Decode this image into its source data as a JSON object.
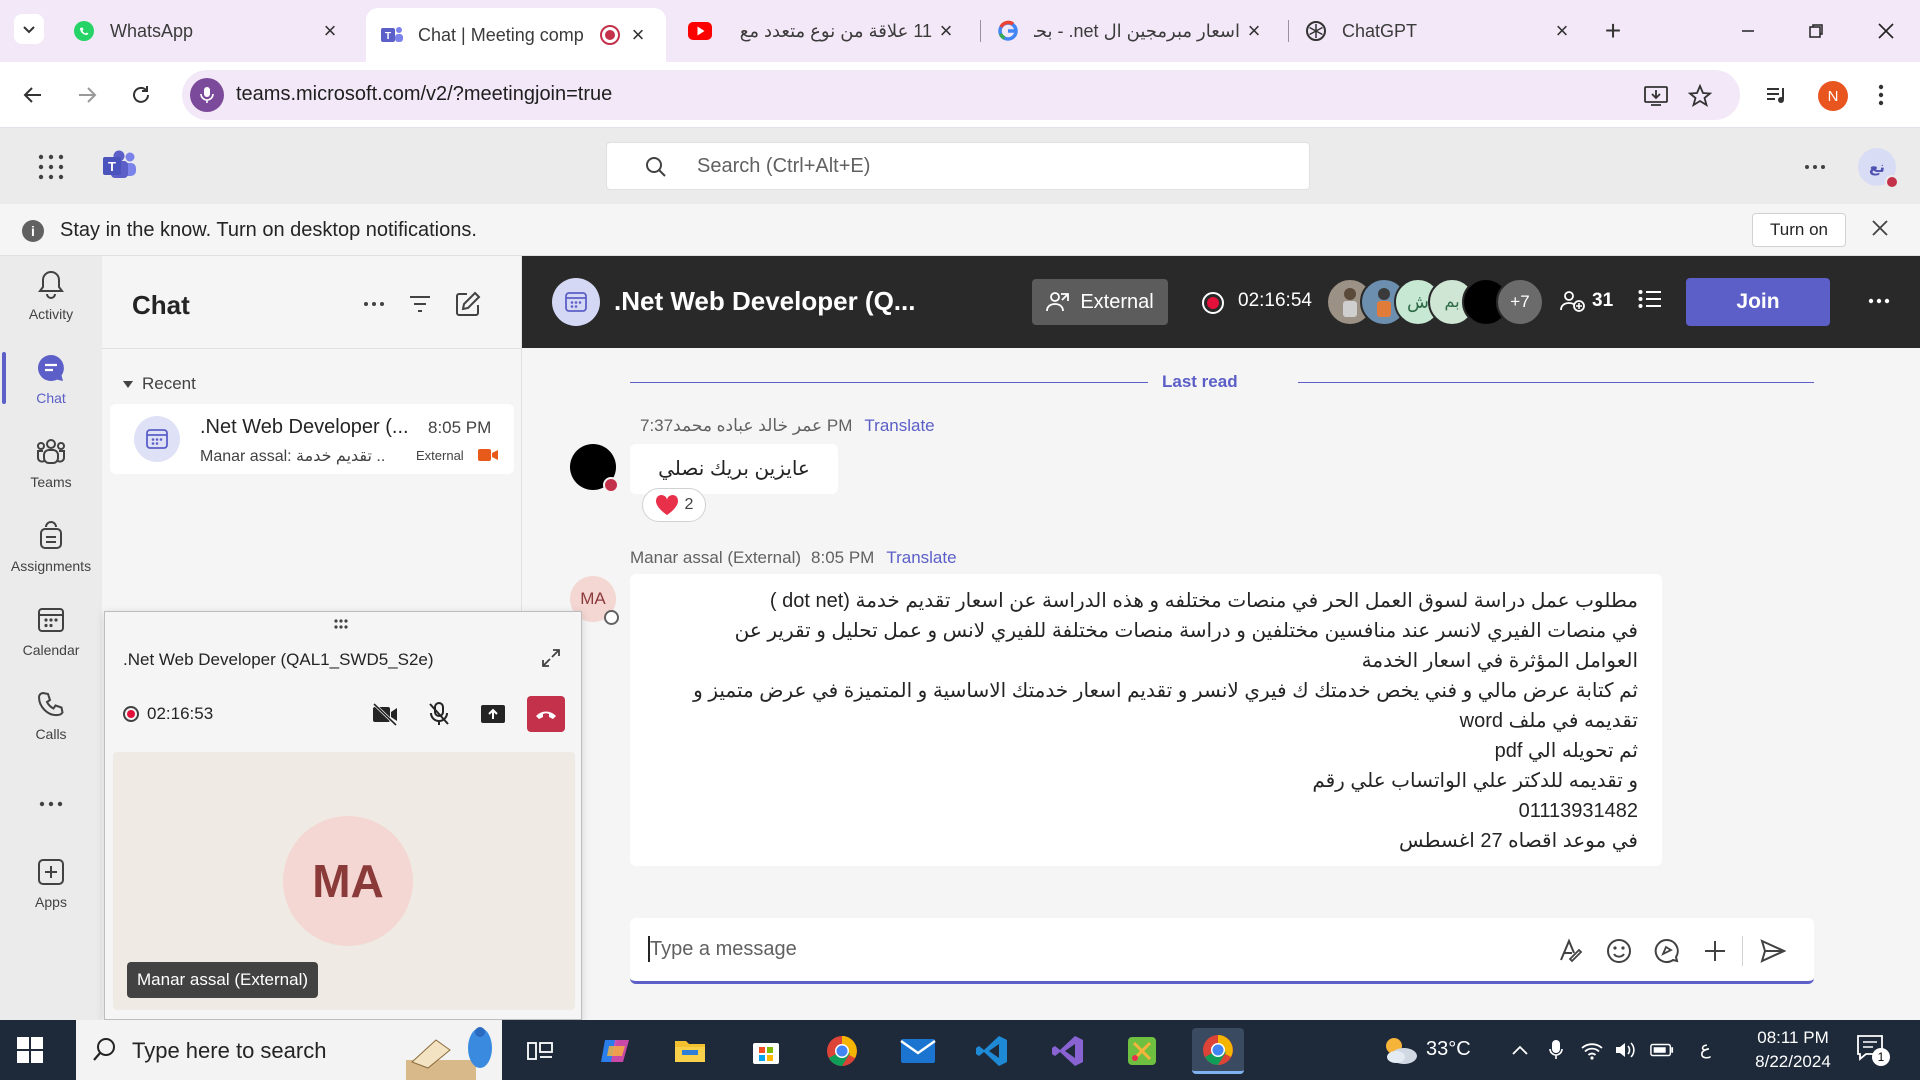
{
  "browser": {
    "tabs": [
      {
        "label": "WhatsApp",
        "icon": "whatsapp-icon"
      },
      {
        "label": "Chat | Meeting comp",
        "icon": "teams-icon"
      },
      {
        "label": "11 علاقة من نوع متعدد مع",
        "icon": "youtube-icon"
      },
      {
        "label": "اسعار مبرمجين ال net. - بحث",
        "icon": "google-icon"
      },
      {
        "label": "ChatGPT",
        "icon": "chatgpt-icon"
      }
    ],
    "new_tab_label": "+",
    "url": "teams.microsoft.com/v2/?meetingjoin=true",
    "profile_initial": "N"
  },
  "teams": {
    "search_placeholder": "Search (Ctrl+Alt+E)",
    "user_initials": "نع",
    "notification": {
      "text": "Stay in the know. Turn on desktop notifications.",
      "button": "Turn on"
    },
    "rail": [
      {
        "label": "Activity",
        "icon": "bell-icon"
      },
      {
        "label": "Chat",
        "icon": "chat-icon"
      },
      {
        "label": "Teams",
        "icon": "teams-people-icon"
      },
      {
        "label": "Assignments",
        "icon": "assignments-icon"
      },
      {
        "label": "Calendar",
        "icon": "calendar-icon"
      },
      {
        "label": "Calls",
        "icon": "phone-icon"
      },
      {
        "label": "...",
        "icon": "more-icon"
      },
      {
        "label": "Apps",
        "icon": "apps-icon"
      }
    ],
    "chat_pane": {
      "title": "Chat",
      "section": "Recent",
      "items": [
        {
          "name": ".Net Web Developer (...",
          "time": "8:05 PM",
          "preview": "Manar assal: تقديم خدمة ...",
          "badge": "External"
        }
      ]
    },
    "meeting": {
      "title": ".Net Web Developer (Q...",
      "external_label": "External",
      "timer": "02:16:54",
      "participant_initials": [
        "ش",
        "بم"
      ],
      "overflow_count": "+7",
      "people_count": "31",
      "join_label": "Join"
    },
    "conversation": {
      "last_read": "Last read",
      "messages": [
        {
          "sender": "عمر خالد عباده محمد",
          "time": "7:37 PM",
          "translate": "Translate",
          "text": "عايزين بريك نصلي",
          "reaction_count": "2"
        },
        {
          "sender": "Manar assal (External)",
          "avatar": "MA",
          "time": "8:05 PM",
          "translate": "Translate",
          "lines": [
            "مطلوب عمل دراسة لسوق العمل الحر في منصات مختلفه و هذه الدراسة عن اسعار تقديم خدمة (dot net )",
            "في منصات الفيري لانسر عند منافسين مختلفين و دراسة منصات مختلفة للفيري لانس و عمل تحليل و تقرير عن",
            "العوامل المؤثرة في اسعار الخدمة",
            "ثم كتابة عرض مالي و فني يخص خدمتك ك فيري لانسر  و تقديم اسعار خدمتك الاساسية و المتميزة في عرض متميز و",
            "تقديمه في ملف word",
            "ثم تحويله الي pdf",
            "و تقديمه للدكتر علي الواتساب علي رقم",
            "01113931482",
            "في موعد اقصاه 27 اغسطس"
          ]
        }
      ],
      "compose_placeholder": "Type a message"
    },
    "call_window": {
      "title": ".Net Web Developer (QAL1_SWD5_S2e)",
      "timer": "02:16:53",
      "avatar": "MA",
      "name_tag": "Manar assal (External)"
    }
  },
  "taskbar": {
    "search_placeholder": "Type here to search",
    "temperature": "33°C",
    "language": "ع",
    "time": "08:11 PM",
    "date": "8/22/2024",
    "notification_count": "1"
  },
  "colors": {
    "teams_accent": "#5b5fc7",
    "record_red": "#e3103a",
    "hangup_red": "#c4314b",
    "meeting_header": "#292929"
  }
}
